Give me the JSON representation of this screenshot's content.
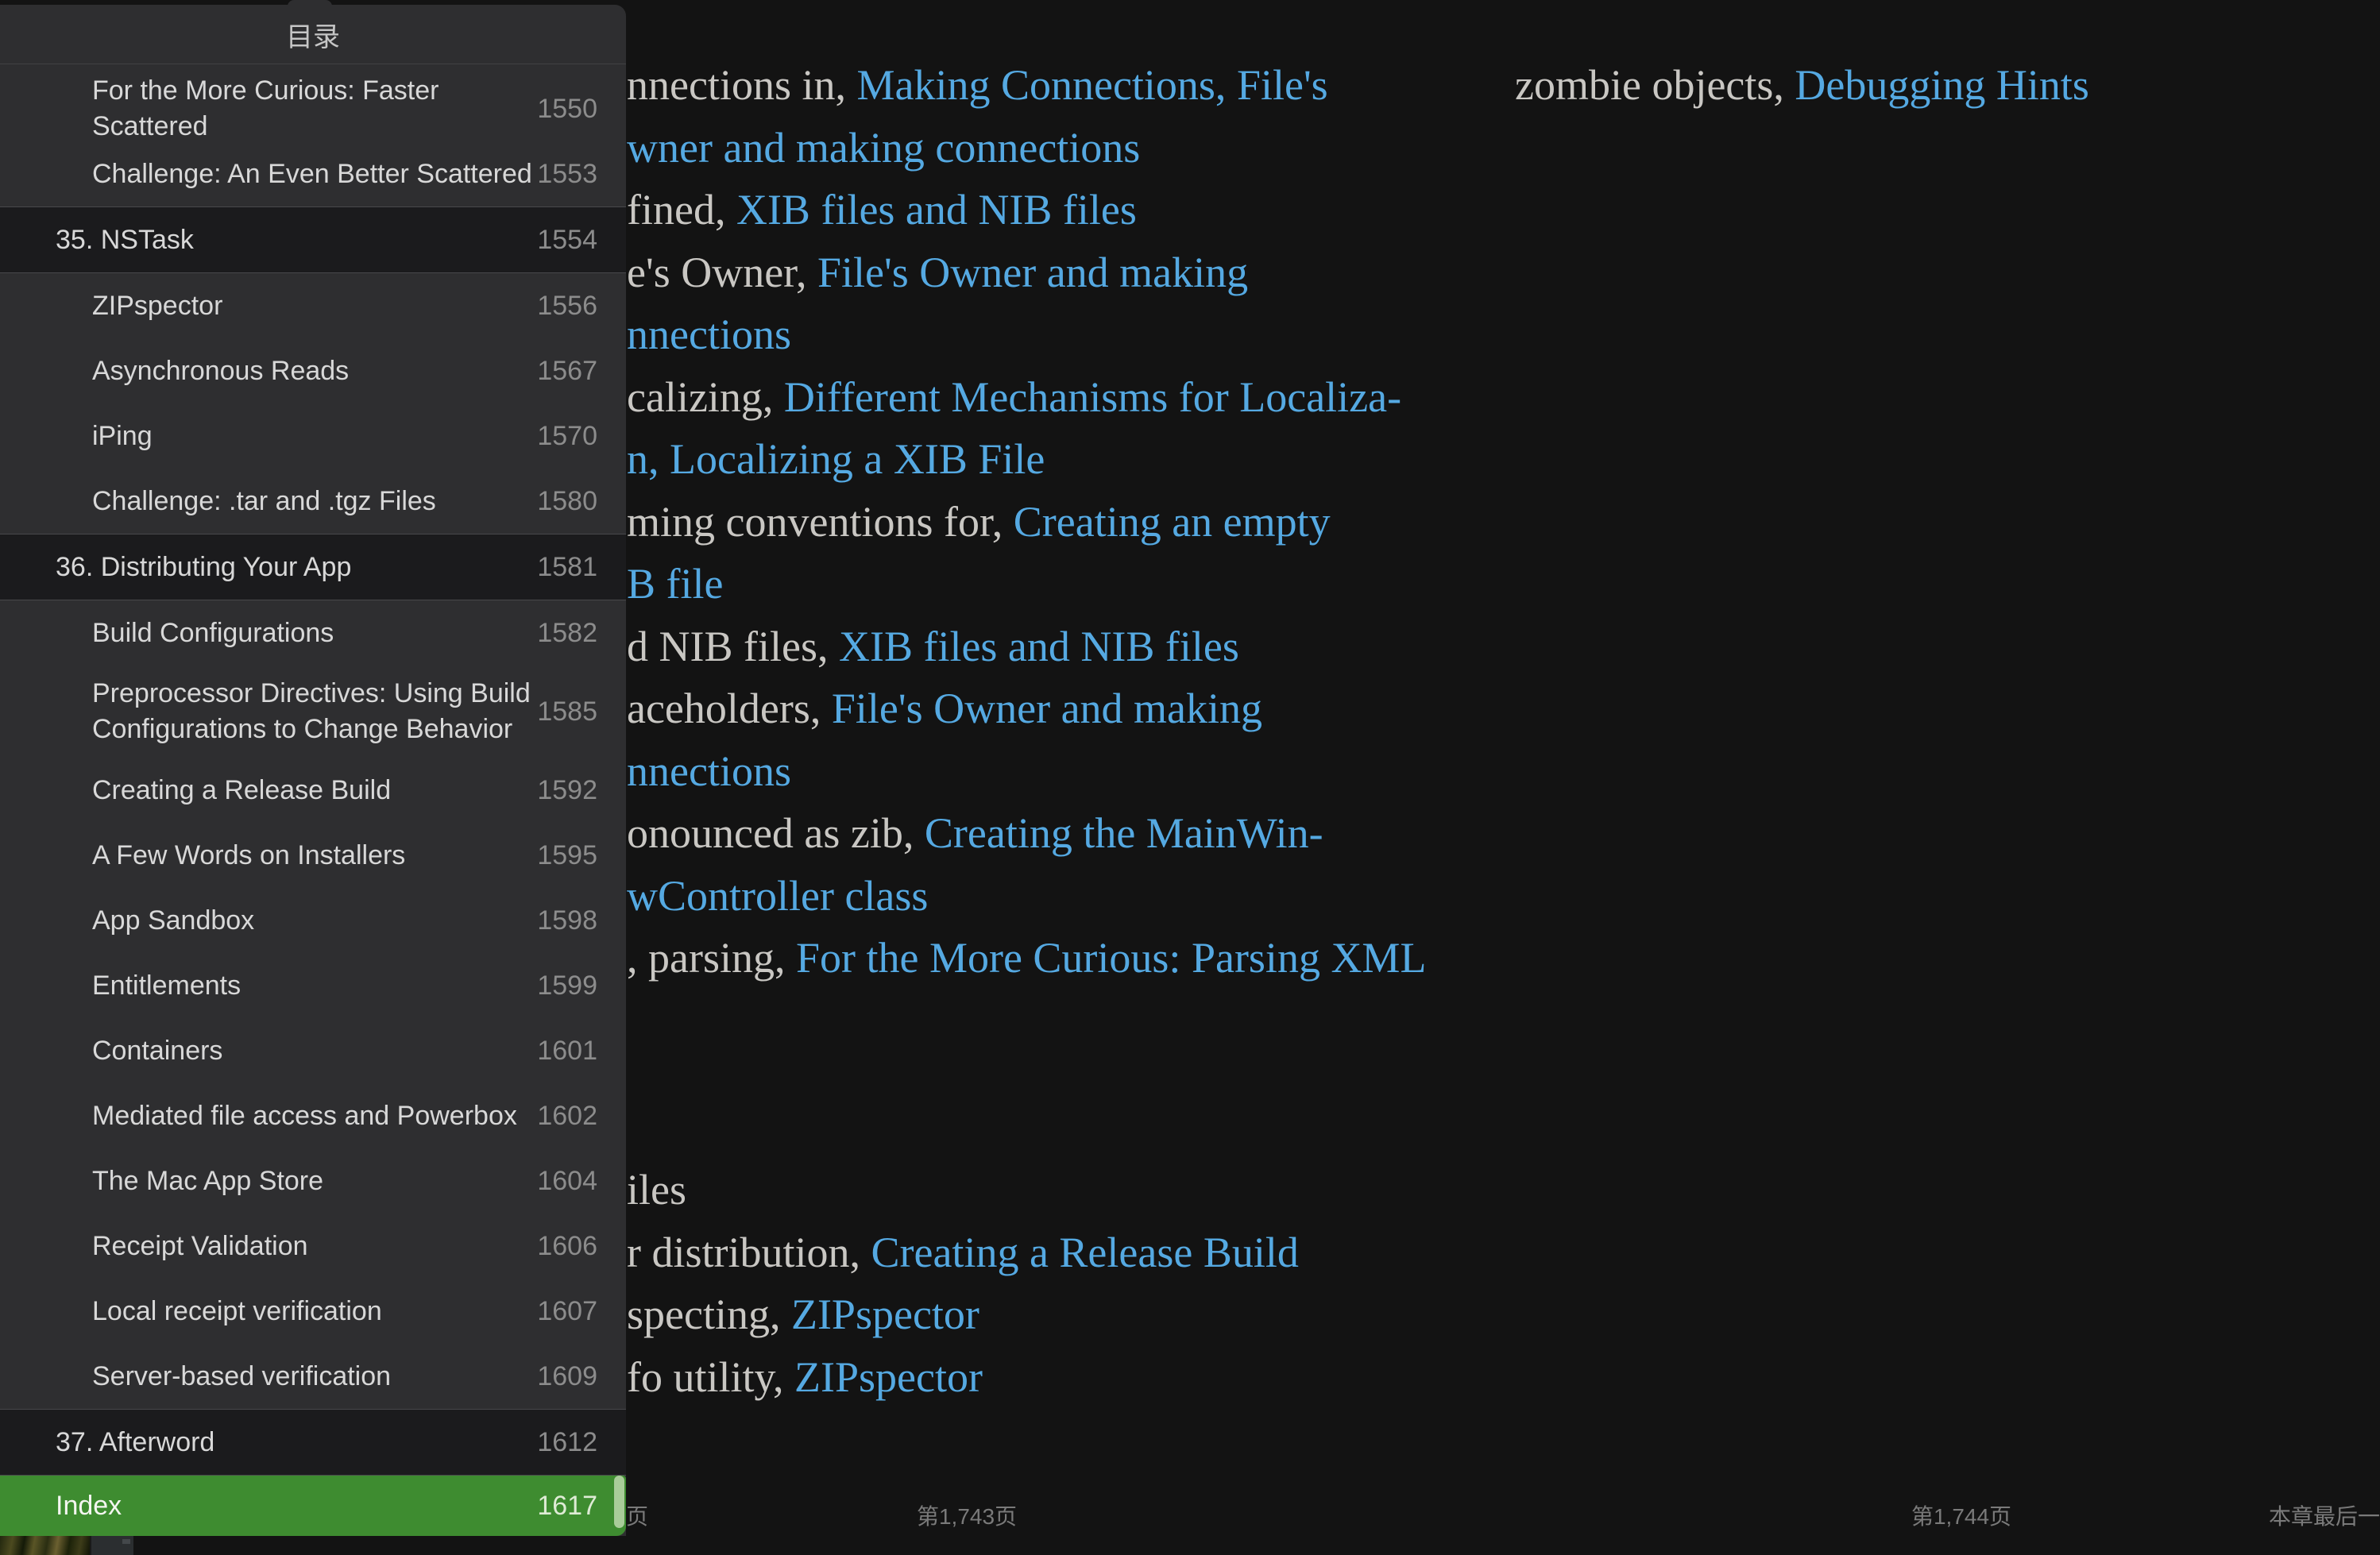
{
  "toc": {
    "title": "目录",
    "items": [
      {
        "label": "For the More Curious: Faster Scattered",
        "page": "1550",
        "type": "sub"
      },
      {
        "label": "Challenge: An Even Better Scattered",
        "page": "1553",
        "type": "sub"
      },
      {
        "label": "35. NSTask",
        "page": "1554",
        "type": "chapter"
      },
      {
        "label": "ZIPspector",
        "page": "1556",
        "type": "sub"
      },
      {
        "label": "Asynchronous Reads",
        "page": "1567",
        "type": "sub"
      },
      {
        "label": "iPing",
        "page": "1570",
        "type": "sub"
      },
      {
        "label": "Challenge: .tar and .tgz Files",
        "page": "1580",
        "type": "sub"
      },
      {
        "label": "36. Distributing Your App",
        "page": "1581",
        "type": "chapter"
      },
      {
        "label": "Build Configurations",
        "page": "1582",
        "type": "sub"
      },
      {
        "label": "Preprocessor Directives: Using Build Configurations to Change Behavior",
        "page": "1585",
        "type": "sub-twoline"
      },
      {
        "label": "Creating a Release Build",
        "page": "1592",
        "type": "sub"
      },
      {
        "label": "A Few Words on Installers",
        "page": "1595",
        "type": "sub"
      },
      {
        "label": "App Sandbox",
        "page": "1598",
        "type": "sub"
      },
      {
        "label": "Entitlements",
        "page": "1599",
        "type": "sub"
      },
      {
        "label": "Containers",
        "page": "1601",
        "type": "sub"
      },
      {
        "label": "Mediated file access and Powerbox",
        "page": "1602",
        "type": "sub"
      },
      {
        "label": "The Mac App Store",
        "page": "1604",
        "type": "sub"
      },
      {
        "label": "Receipt Validation",
        "page": "1606",
        "type": "sub"
      },
      {
        "label": "Local receipt verification",
        "page": "1607",
        "type": "sub"
      },
      {
        "label": "Server-based verification",
        "page": "1609",
        "type": "sub"
      },
      {
        "label": "37. Afterword",
        "page": "1612",
        "type": "chapter"
      },
      {
        "label": "Index",
        "page": "1617",
        "type": "selected"
      }
    ]
  },
  "main": {
    "left_lines": [
      {
        "spans": [
          {
            "text": "nnections in, ",
            "link": false
          },
          {
            "text": "Making Connections,",
            "link": true
          },
          {
            "text": " ",
            "link": false
          },
          {
            "text": "File's",
            "link": true
          }
        ]
      },
      {
        "spans": [
          {
            "text": "wner and making connections",
            "link": true
          }
        ]
      },
      {
        "spans": [
          {
            "text": "fined, ",
            "link": false
          },
          {
            "text": "XIB files and NIB files",
            "link": true
          }
        ]
      },
      {
        "spans": [
          {
            "text": "e's Owner, ",
            "link": false
          },
          {
            "text": "File's Owner and making",
            "link": true
          }
        ]
      },
      {
        "spans": [
          {
            "text": "nnections",
            "link": true
          }
        ]
      },
      {
        "spans": [
          {
            "text": "calizing, ",
            "link": false
          },
          {
            "text": "Different Mechanisms for Localiza-",
            "link": true
          }
        ]
      },
      {
        "spans": [
          {
            "text": "n, ",
            "link": true
          },
          {
            "text": "Localizing a XIB File",
            "link": true
          }
        ]
      },
      {
        "spans": [
          {
            "text": "ming conventions for, ",
            "link": false
          },
          {
            "text": "Creating an empty",
            "link": true
          }
        ]
      },
      {
        "spans": [
          {
            "text": "B file",
            "link": true
          }
        ]
      },
      {
        "spans": [
          {
            "text": "d NIB files, ",
            "link": false
          },
          {
            "text": "XIB files and NIB files",
            "link": true
          }
        ]
      },
      {
        "spans": [
          {
            "text": "aceholders, ",
            "link": false
          },
          {
            "text": "File's Owner and making",
            "link": true
          }
        ]
      },
      {
        "spans": [
          {
            "text": "nnections",
            "link": true
          }
        ]
      },
      {
        "spans": [
          {
            "text": "onounced as zib, ",
            "link": false
          },
          {
            "text": "Creating the MainWin-",
            "link": true
          }
        ]
      },
      {
        "spans": [
          {
            "text": "wController class",
            "link": true
          }
        ]
      },
      {
        "spans": [
          {
            "text": ", parsing, ",
            "link": false
          },
          {
            "text": "For the More Curious: Parsing XML",
            "link": true
          }
        ]
      }
    ],
    "bottom_lines": [
      {
        "spans": [
          {
            "text": "iles",
            "link": false
          }
        ]
      },
      {
        "spans": [
          {
            "text": "r distribution, ",
            "link": false
          },
          {
            "text": "Creating a Release Build",
            "link": true
          }
        ]
      },
      {
        "spans": [
          {
            "text": "specting, ",
            "link": false
          },
          {
            "text": "ZIPspector",
            "link": true
          }
        ]
      },
      {
        "spans": [
          {
            "text": "fo utility, ",
            "link": false
          },
          {
            "text": "ZIPspector",
            "link": true
          }
        ]
      }
    ],
    "right_lines": [
      {
        "spans": [
          {
            "text": "zombie objects, ",
            "link": false
          },
          {
            "text": "Debugging Hints",
            "link": true
          }
        ]
      }
    ]
  },
  "footer": {
    "left_clipped": "页",
    "left_page": "第1,743页",
    "right_page": "第1,744页",
    "chapter_end": "本章最后一"
  },
  "colors": {
    "accent_green": "#3E8C30",
    "link_blue": "#55A9E2"
  }
}
